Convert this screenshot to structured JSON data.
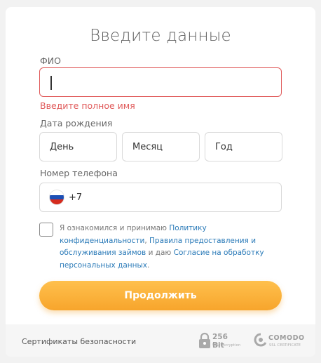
{
  "form": {
    "title": "Введите данные",
    "fio": {
      "label": "ФИО",
      "value": "",
      "error": "Введите полное имя"
    },
    "birth_date": {
      "label": "Дата рождения",
      "day_placeholder": "День",
      "month_placeholder": "Месяц",
      "year_placeholder": "Год"
    },
    "phone": {
      "label": "Номер телефона",
      "country_code": "+7",
      "flag_icon": "russia-flag-icon"
    },
    "consent": {
      "checked": false,
      "text_1": "Я ознакомился и принимаю ",
      "link_1": "Политику конфиденциальности",
      "text_2": ", ",
      "link_2": "Правила предоставления и обслуживания займов",
      "text_3": " и даю ",
      "link_3": "Согласие на обработку персональных данных",
      "text_4": "."
    },
    "submit_label": "Продолжить"
  },
  "footer": {
    "label": "Сертификаты безопасности",
    "ssl_badge": {
      "title": "256 Bit",
      "subtitle": "SSL Encryption",
      "icon": "padlock-icon"
    },
    "comodo_badge": {
      "title": "COMODO",
      "subtitle": "SSL CERTIFICATE",
      "icon": "comodo-logo-icon"
    }
  },
  "colors": {
    "error": "#e05a5a",
    "link": "#2a7ab8",
    "button": "#f7a52c",
    "border": "#d9d9d9"
  }
}
